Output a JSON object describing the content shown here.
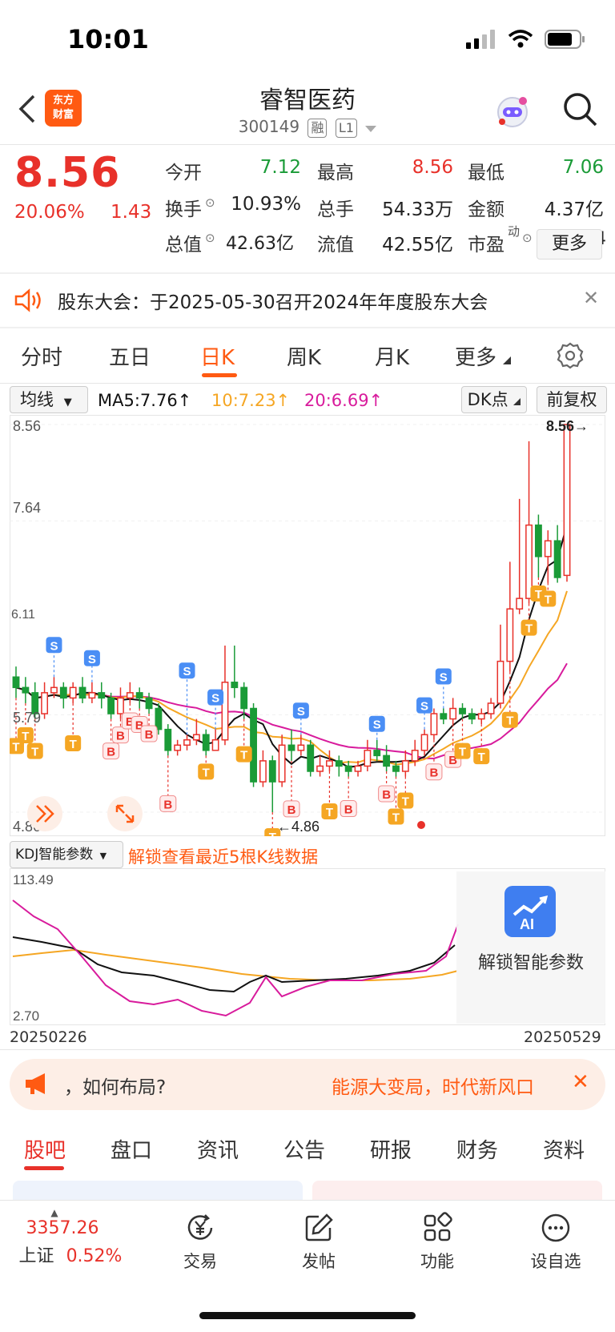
{
  "status": {
    "time": "10:01"
  },
  "header": {
    "logo_text": [
      "东方",
      "财富"
    ],
    "stock_name": "睿智医药",
    "stock_code": "300149",
    "tag_margin": "融",
    "tag_level": "L1"
  },
  "quote": {
    "price": "8.56",
    "pct": "20.06%",
    "change": "1.43",
    "stats": [
      {
        "label": "今开",
        "value": "7.12",
        "color": "green"
      },
      {
        "label": "最高",
        "value": "8.56",
        "color": "red"
      },
      {
        "label": "最低",
        "value": "7.06",
        "color": "green"
      },
      {
        "label": "换手",
        "value": "10.93%",
        "color": "normal"
      },
      {
        "label": "总手",
        "value": "54.33万",
        "color": "normal"
      },
      {
        "label": "金额",
        "value": "4.37亿",
        "color": "normal"
      },
      {
        "label": "总值",
        "value": "42.63亿",
        "color": "normal"
      },
      {
        "label": "流值",
        "value": "42.55亿",
        "color": "normal"
      },
      {
        "label": "市盈",
        "value": "160.44",
        "color": "normal"
      }
    ],
    "pe_sup": "动",
    "more_label": "更多"
  },
  "notice": {
    "text": "股东大会：于2025-05-30召开2024年年度股东大会"
  },
  "period_tabs": [
    "分时",
    "五日",
    "日K",
    "周K",
    "月K",
    "更多"
  ],
  "ma_bar": {
    "selector": "均线",
    "ma5": "MA5:7.76↑",
    "ma10": "10:7.23↑",
    "ma20": "20:6.69↑",
    "dk_label": "DK点",
    "adjust_label": "前复权"
  },
  "colors": {
    "up": "#e8312a",
    "down": "#1a9b37",
    "ma5": "#111111",
    "ma10": "#f5a623",
    "ma20": "#d81b9c",
    "accent": "#ff5a12"
  },
  "chart_data": [
    {
      "type": "candlestick",
      "y_ticks": [
        "8.56",
        "7.64",
        "5.79",
        "4.86"
      ],
      "ylim": [
        4.86,
        8.56
      ],
      "annotations": {
        "high": "8.56→",
        "low": "←4.86"
      },
      "left_label": "6.11",
      "x_start": "20250226",
      "x_end": "20250529",
      "candles": [
        [
          6.15,
          6.05,
          6.25,
          5.95
        ],
        [
          6.05,
          6.0,
          6.15,
          5.9
        ],
        [
          6.0,
          5.8,
          6.1,
          5.75
        ],
        [
          5.8,
          6.0,
          6.1,
          5.75
        ],
        [
          6.0,
          6.05,
          6.15,
          5.95
        ],
        [
          6.05,
          5.95,
          6.1,
          5.85
        ],
        [
          5.95,
          6.05,
          6.1,
          5.9
        ],
        [
          6.05,
          5.95,
          6.15,
          5.9
        ],
        [
          5.95,
          6.0,
          6.1,
          5.9
        ],
        [
          6.0,
          5.95,
          6.1,
          5.85
        ],
        [
          5.95,
          5.8,
          6.0,
          5.75
        ],
        [
          5.8,
          5.95,
          6.05,
          5.75
        ],
        [
          5.95,
          6.0,
          6.1,
          5.9
        ],
        [
          6.0,
          5.95,
          6.05,
          5.85
        ],
        [
          5.95,
          5.85,
          6.0,
          5.8
        ],
        [
          5.85,
          5.65,
          5.9,
          5.6
        ],
        [
          5.65,
          5.45,
          5.7,
          5.4
        ],
        [
          5.45,
          5.5,
          5.55,
          5.4
        ],
        [
          5.5,
          5.55,
          5.6,
          5.45
        ],
        [
          5.55,
          5.6,
          5.75,
          5.5
        ],
        [
          5.6,
          5.45,
          5.65,
          5.4
        ],
        [
          5.45,
          5.55,
          5.65,
          5.45
        ],
        [
          5.55,
          6.1,
          6.45,
          5.5
        ],
        [
          6.1,
          6.05,
          6.45,
          5.95
        ],
        [
          6.05,
          5.85,
          6.1,
          5.75
        ],
        [
          5.85,
          5.15,
          5.9,
          5.1
        ],
        [
          5.15,
          5.35,
          5.45,
          5.1
        ],
        [
          5.35,
          5.15,
          5.4,
          4.86
        ],
        [
          5.15,
          5.5,
          5.6,
          5.1
        ],
        [
          5.5,
          5.45,
          5.65,
          5.35
        ],
        [
          5.45,
          5.5,
          5.6,
          5.4
        ],
        [
          5.5,
          5.25,
          5.55,
          5.2
        ],
        [
          5.25,
          5.3,
          5.4,
          5.2
        ],
        [
          5.3,
          5.35,
          5.45,
          5.25
        ],
        [
          5.35,
          5.3,
          5.4,
          5.2
        ],
        [
          5.3,
          5.25,
          5.35,
          5.2
        ],
        [
          5.25,
          5.3,
          5.35,
          5.2
        ],
        [
          5.3,
          5.45,
          5.55,
          5.25
        ],
        [
          5.45,
          5.4,
          5.55,
          5.35
        ],
        [
          5.4,
          5.3,
          5.5,
          5.25
        ],
        [
          5.3,
          5.25,
          5.35,
          5.2
        ],
        [
          5.25,
          5.35,
          5.45,
          5.2
        ],
        [
          5.35,
          5.45,
          5.55,
          5.3
        ],
        [
          5.45,
          5.6,
          5.65,
          5.4
        ],
        [
          5.6,
          5.8,
          5.85,
          5.55
        ],
        [
          5.8,
          5.75,
          5.85,
          5.7
        ],
        [
          5.75,
          5.85,
          5.95,
          5.7
        ],
        [
          5.85,
          5.8,
          5.9,
          5.75
        ],
        [
          5.8,
          5.75,
          5.85,
          5.7
        ],
        [
          5.75,
          5.8,
          5.85,
          5.7
        ],
        [
          5.8,
          5.9,
          5.95,
          5.75
        ],
        [
          5.9,
          6.3,
          6.65,
          5.85
        ],
        [
          6.3,
          6.8,
          7.25,
          6.2
        ],
        [
          6.8,
          6.9,
          7.85,
          6.75
        ],
        [
          6.9,
          7.6,
          8.4,
          6.85
        ],
        [
          7.6,
          7.3,
          7.7,
          7.1
        ],
        [
          7.3,
          7.45,
          7.55,
          7.05
        ],
        [
          7.45,
          7.1,
          7.6,
          7.05
        ],
        [
          7.12,
          8.56,
          8.56,
          7.06
        ]
      ]
    },
    {
      "type": "line",
      "title": "KDJ智能参数",
      "y_ticks": [
        "113.49",
        "2.70"
      ],
      "ylim": [
        2.7,
        113.49
      ]
    }
  ],
  "kdj": {
    "selector": "KDJ智能参数",
    "unlock_text": "解锁查看最近5根K线数据",
    "ai_label": "解锁智能参数",
    "ai_badge": "AI"
  },
  "promo": {
    "left_text": "，如何布局?",
    "right_text": "能源大变局，时代新风口"
  },
  "bottom_tabs": [
    "股吧",
    "盘口",
    "资讯",
    "公告",
    "研报",
    "财务",
    "资料"
  ],
  "tabbar": {
    "index_value": "3357.26",
    "index_name": "上证",
    "index_pct": "0.52%",
    "items": [
      "交易",
      "发帖",
      "功能",
      "设自选"
    ]
  }
}
